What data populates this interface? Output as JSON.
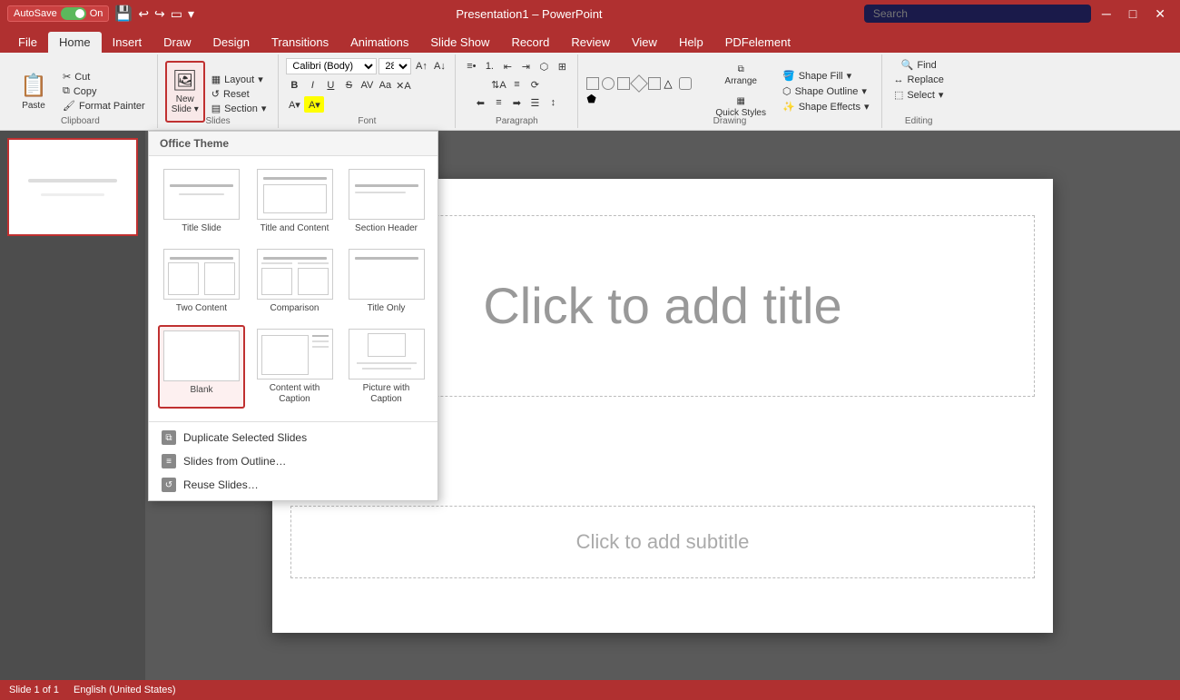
{
  "titlebar": {
    "autosave_label": "AutoSave",
    "toggle_state": "On",
    "title": "Presentation1 – PowerPoint",
    "search_placeholder": "Search"
  },
  "tabs": [
    {
      "id": "file",
      "label": "File"
    },
    {
      "id": "home",
      "label": "Home",
      "active": true
    },
    {
      "id": "insert",
      "label": "Insert"
    },
    {
      "id": "draw",
      "label": "Draw"
    },
    {
      "id": "design",
      "label": "Design"
    },
    {
      "id": "transitions",
      "label": "Transitions"
    },
    {
      "id": "animations",
      "label": "Animations"
    },
    {
      "id": "slideshow",
      "label": "Slide Show"
    },
    {
      "id": "record",
      "label": "Record"
    },
    {
      "id": "review",
      "label": "Review"
    },
    {
      "id": "view",
      "label": "View"
    },
    {
      "id": "help",
      "label": "Help"
    },
    {
      "id": "pdfelem",
      "label": "PDFelement"
    }
  ],
  "ribbon": {
    "clipboard_label": "Clipboard",
    "slides_label": "Slides",
    "font_label": "Font",
    "paragraph_label": "Paragraph",
    "drawing_label": "Drawing",
    "editing_label": "Editing",
    "paste_label": "Paste",
    "cut_label": "Cut",
    "copy_label": "Copy",
    "format_painter_label": "Format Painter",
    "new_slide_label": "New\nSlide",
    "layout_label": "Layout",
    "reset_label": "Reset",
    "section_label": "Section",
    "font_name": "Calibri (Body)",
    "font_size": "28",
    "bold_label": "B",
    "italic_label": "I",
    "underline_label": "U",
    "find_label": "Find",
    "replace_label": "Replace",
    "select_label": "Select",
    "arrange_label": "Arrange",
    "quick_styles_label": "Quick\nStyles",
    "shape_fill_label": "Shape Fill",
    "shape_outline_label": "Shape Outline",
    "shape_effects_label": "Shape Effects"
  },
  "dropdown": {
    "header": "Office Theme",
    "layouts": [
      {
        "id": "title-slide",
        "label": "Title Slide"
      },
      {
        "id": "title-content",
        "label": "Title and Content"
      },
      {
        "id": "section-header",
        "label": "Section Header"
      },
      {
        "id": "two-content",
        "label": "Two Content"
      },
      {
        "id": "comparison",
        "label": "Comparison"
      },
      {
        "id": "title-only",
        "label": "Title Only"
      },
      {
        "id": "blank",
        "label": "Blank",
        "selected": true
      },
      {
        "id": "content-caption",
        "label": "Content with\nCaption"
      },
      {
        "id": "picture-caption",
        "label": "Picture with\nCaption"
      }
    ],
    "actions": [
      {
        "id": "duplicate",
        "label": "Duplicate Selected Slides"
      },
      {
        "id": "from-outline",
        "label": "Slides from Outline…"
      },
      {
        "id": "reuse",
        "label": "Reuse Slides…"
      }
    ]
  },
  "slide": {
    "number": "1",
    "title_placeholder": "Click to add title",
    "subtitle_placeholder": "Click to add subtitle"
  },
  "statusbar": {
    "slide_info": "Slide 1 of 1",
    "language": "English (United States)"
  }
}
